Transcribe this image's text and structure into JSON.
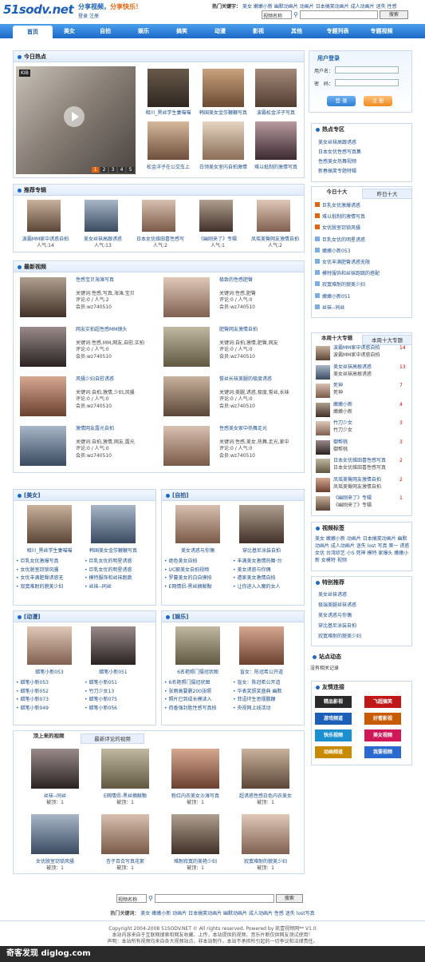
{
  "header": {
    "logo": "51sodv.net",
    "slogan1": "分享视频，",
    "slogan2": "分享快乐！",
    "login": "登录",
    "register": "注册",
    "hot_label": "热门关键字：",
    "hot_keywords": [
      "美女",
      "嫩嫩小新",
      "幽默动画片",
      "动画片",
      "日本搞笑动画片",
      "成人动画片",
      "迷失",
      "性感"
    ],
    "search_select": "视频名称",
    "search_button": "搜索"
  },
  "nav": [
    "首页",
    "美女",
    "自拍",
    "娱乐",
    "搞笑",
    "动漫",
    "影视",
    "其他",
    "专题列表",
    "专题视频"
  ],
  "today_hot": {
    "title": "今日热点",
    "pages": [
      "1",
      "2",
      "3",
      "4",
      "5"
    ],
    "thumbs": [
      {
        "cap": "相川_黑丝学生妻喵喵"
      },
      {
        "cap": "韩国美女金莎鞭鞭写真"
      },
      {
        "cap": "波霸松金洋子写真"
      },
      {
        "cap": "松金洋子在公交车上"
      },
      {
        "cap": "白领美女室内自拍激情"
      },
      {
        "cap": "难以抵制的激情写真"
      }
    ]
  },
  "login_box": {
    "title": "用户登录",
    "user_label": "用户名：",
    "pass_label": "密　码：",
    "login_btn": "登 录",
    "reg_btn": "注 册"
  },
  "special_topics": {
    "title": "热点专区",
    "items": [
      "美女丝袜高跟诱惑",
      "日本女优性感写真集",
      "性感美女热舞视频",
      "新春搞笑专题特辑"
    ]
  },
  "rank_tabs": {
    "tab1": "今日十大",
    "tab2": "昨日十大",
    "items": [
      "巨乳女优激爆诱惑",
      "难以抵制的激情写真",
      "女优脱室窃锁风骚",
      "巨乳女优的明星诱惑",
      "嫩嫩小新053",
      "女优丰满肥臀诱惑无限",
      "模特服饰和丝袜跑跳的搭配",
      "寂寞难耐的貌美少妇",
      "嫩嫩小新051",
      "丝袜--同丝"
    ]
  },
  "weekly": {
    "tab1": "本周十大专辑",
    "tab2": "本周十大专题",
    "items": [
      {
        "t": "波霸MM家中诱惑自拍",
        "s": "波霸MM家中诱惑自拍",
        "n": "14"
      },
      {
        "t": "美女丝袜高根诱惑",
        "s": "美女丝袜高根诱惑",
        "n": "13"
      },
      {
        "t": "死神",
        "s": "死神",
        "n": "7"
      },
      {
        "t": "嫩嫩小新",
        "s": "嫩嫩小新",
        "n": "4"
      },
      {
        "t": "竹刀少女",
        "s": "竹刀少女",
        "n": "3"
      },
      {
        "t": "御帮桃",
        "s": "御帮桃",
        "n": "3"
      },
      {
        "t": "日本女优维田喜性感写真",
        "s": "日本女优维田喜性感写真",
        "n": "2"
      },
      {
        "t": "凤瑶美臀网友激情自拍",
        "s": "凤瑶美臀网友激情自拍",
        "n": "2"
      },
      {
        "t": "《幽刚来了》专辑",
        "s": "《幽刚来了》专辑",
        "n": "1"
      }
    ]
  },
  "recommend": {
    "title": "推荐专辑",
    "items": [
      {
        "cap": "波霸MM家中诱惑自拍",
        "pop": "人气:14"
      },
      {
        "cap": "美女丝袜高跟诱惑",
        "pop": "人气:13"
      },
      {
        "cap": "日本女优维田喜性感写",
        "pop": "人气:2"
      },
      {
        "cap": "《幽刚来了》专辑",
        "pop": "人气:1"
      },
      {
        "cap": "凤瑶美臀网友激情自拍",
        "pop": "人气:2"
      }
    ]
  },
  "latest": {
    "title": "最新视频",
    "items": [
      {
        "t": "性感宝贝海滩写真",
        "k": "关键词:性感,写真,海滩,宝贝",
        "c": "评论:0 / 人气:2",
        "u": "会员:wz740510"
      },
      {
        "t": "极致的性感肥臀",
        "k": "关键词:性感,肥臀",
        "c": "评论:0 / 人气:0",
        "u": "会员:wz740510"
      },
      {
        "t": "网友实拍超性感MM镜头",
        "k": "关键词:性感,MM,网友,自慰,实拍",
        "c": "评论:0 / 人气:0",
        "u": "会员:wz740510"
      },
      {
        "t": "肥臀网友激情自拍",
        "k": "关键词:自拍,激情,肥臀,网友",
        "c": "评论:0 / 人气:0",
        "u": "会员:wz740510"
      },
      {
        "t": "风骚少妇自慰诱惑",
        "k": "关键词:自拍,激情,少妇,风骚",
        "c": "评论:0 / 人气:0",
        "u": "会员:wz740510"
      },
      {
        "t": "誓丝长袜美腿的极度诱惑",
        "k": "关键词:美腿,诱惑,极度,誓丝,长袜",
        "c": "评论:0 / 人气:0",
        "u": "会员:wz740510"
      },
      {
        "t": "激情网友露光自拍",
        "k": "关键词:自拍,激情,网友,露光",
        "c": "评论:0 / 人气:0",
        "u": "会员:wz740510"
      },
      {
        "t": "性感美女家中热舞走光",
        "k": "关键词:性感,美女,热舞,走光,家中",
        "c": "评论:0 / 人气:0",
        "u": "会员:wz740510"
      }
    ]
  },
  "tags": {
    "title": "视频标签",
    "text": "美女 嫩嫩小新 动画片 日本搞笑动画片 幽默动画片 成人动画片 迷失 lost 写真 第一 诱惑 女优 台湾综艺 小S 死神 模特 家爆头 嫩嫩小新 女模特 视频"
  },
  "features": {
    "title": "特别推荐",
    "items": [
      "美女丝袜诱惑",
      "极端美腿丝袜诱惑",
      "美女诱惑与你偶",
      "穿比基尼泳装自拍",
      "寂寞难耐的貌美少妇"
    ]
  },
  "site_news": {
    "title": "站点动态",
    "text": "没有相关记录"
  },
  "friend_links": {
    "title": "友情连接",
    "items": [
      "精品影视",
      "飞超搞笑",
      "游戏频道",
      "好看影视",
      "快乐视频",
      "美女视频",
      "动画频道",
      "我要视频"
    ]
  },
  "cat_beauty": {
    "title": "[美女]",
    "thumbs": [
      "相川_黑丝学生妻喵喵",
      "韩国美女金莎鞭鞭写真"
    ],
    "list": [
      "巨乳女优激爆写真",
      "巨乳女优的明星诱惑",
      "女优脱室窃锁风骚",
      "巨乳女优的明星诱惑",
      "女优丰满肥臀诱惑无",
      "模特服饰和丝袜跑跳",
      "寂寞难耐的貌美少妇",
      "丝袜--同丝"
    ]
  },
  "cat_selfie": {
    "title": "[自拍]",
    "thumbs": [
      "美女诱惑与你偶",
      "穿比基尼泳装自拍"
    ],
    "list": [
      "绝色美女自拍",
      "丰满美女激情热舞·台",
      "UC聊美女自拍视频",
      "美女诱惑与你偶",
      "罗蔓美女的白自摸拍",
      "遭家美女激情自拍",
      "E网情侣-黑丝摘献黝",
      "让你进入入魔的女人"
    ]
  },
  "cat_anime": {
    "title": "[动漫]",
    "thumbs": [
      "蜡笔小新053",
      "蜡笔小新051"
    ],
    "list": [
      "蜡笔小新053",
      "蜡笔小新051",
      "蜡笔小新052",
      "竹刀少女13",
      "蜡笔小新073",
      "蜡笔小新075",
      "蜡笔小新049",
      "蜡笔小新056"
    ]
  },
  "cat_ent": {
    "title": "[娱乐]",
    "thumbs": [
      "6名艳照门摄冠状图",
      "盲女：陈冠希公开道"
    ],
    "list": [
      "6名艳照门摄冠状图",
      "盲女：陈冠希公开道",
      "张雨高要删200张照",
      "华表奖颁奖盛典 幽默",
      "照片已到成长模读入",
      "菲语环生思摆鹏鞭",
      "荷香强封胜性感写真拍",
      "央视网上线活动"
    ]
  },
  "bottom": {
    "tab1": "顶上来的视频",
    "tab2": "最新评论的视频",
    "items": [
      {
        "cap": "丝袜--同丝",
        "v": "被顶：1"
      },
      {
        "cap": "E网情侣-黑丝摘献黝",
        "v": "被顶：1"
      },
      {
        "cap": "粉红内衣美女沙滩写真",
        "v": "被顶：1"
      },
      {
        "cap": "超诱惑性感白色内衣美女",
        "v": "被顶：1"
      },
      {
        "cap": "女优脱室窃锁风骚",
        "v": "被顶：1"
      },
      {
        "cap": "杏子百合写真花絮",
        "v": "被顶：1"
      },
      {
        "cap": "难耐寂寞的美艳少妇",
        "v": "被顶：1"
      },
      {
        "cap": "寂寞难耐的貌美少妇",
        "v": "被顶：1"
      }
    ]
  },
  "footer": {
    "select": "视频名称",
    "search": "搜索",
    "hot_label": "热门关键词：",
    "hot": [
      "美女",
      "嫩嫩小新",
      "动画片",
      "日本搞笑动画片",
      "幽默动画片",
      "成人动画片",
      "性感",
      "迷失",
      "lost写真"
    ],
    "copy": "Copyright 2004-2008 51SODV.NET © All rights reserved. Powered by 凯壹视频网** V1.0",
    "note1": "本站内容来自于互联网搜索和网友收藏、上传，本站提供的视频、音乐片断仅供网友测试使用！",
    "note2": "声明：本站所有视频均来自各大视频站点，非本站制作，本站不承担所引起的一切争议和法律责任。"
  },
  "watermark": "奇客发现 diglog.com"
}
